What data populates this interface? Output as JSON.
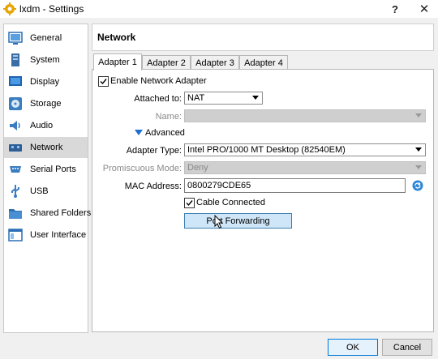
{
  "window": {
    "title": "lxdm - Settings",
    "help_label": "?",
    "close_label": "✕"
  },
  "sidebar": {
    "items": [
      {
        "label": "General",
        "icon": "general-icon",
        "active": false
      },
      {
        "label": "System",
        "icon": "system-icon",
        "active": false
      },
      {
        "label": "Display",
        "icon": "display-icon",
        "active": false
      },
      {
        "label": "Storage",
        "icon": "storage-icon",
        "active": false
      },
      {
        "label": "Audio",
        "icon": "audio-icon",
        "active": false
      },
      {
        "label": "Network",
        "icon": "network-icon",
        "active": true
      },
      {
        "label": "Serial Ports",
        "icon": "serial-ports-icon",
        "active": false
      },
      {
        "label": "USB",
        "icon": "usb-icon",
        "active": false
      },
      {
        "label": "Shared Folders",
        "icon": "shared-folders-icon",
        "active": false
      },
      {
        "label": "User Interface",
        "icon": "user-interface-icon",
        "active": false
      }
    ]
  },
  "panel": {
    "title": "Network"
  },
  "tabs": [
    {
      "label": "Adapter 1",
      "active": true
    },
    {
      "label": "Adapter 2",
      "active": false
    },
    {
      "label": "Adapter 3",
      "active": false
    },
    {
      "label": "Adapter 4",
      "active": false
    }
  ],
  "adapter": {
    "enable_label": "Enable Network Adapter",
    "enable_checked": true,
    "attached_to_label": "Attached to:",
    "attached_to_value": "NAT",
    "name_label": "Name:",
    "name_value": "",
    "advanced_label": "Advanced",
    "adapter_type_label": "Adapter Type:",
    "adapter_type_value": "Intel PRO/1000 MT Desktop (82540EM)",
    "promiscuous_label": "Promiscuous Mode:",
    "promiscuous_value": "Deny",
    "mac_label": "MAC Address:",
    "mac_value": "0800279CDE65",
    "cable_label": "Cable Connected",
    "cable_checked": true,
    "port_forwarding_label": "Port Forwarding"
  },
  "footer": {
    "ok_label": "OK",
    "cancel_label": "Cancel"
  },
  "colors": {
    "accent": "#0078d7",
    "selected_sidebar": "#d9d9d9",
    "port_forwarding_bg": "#cfe6f8"
  }
}
